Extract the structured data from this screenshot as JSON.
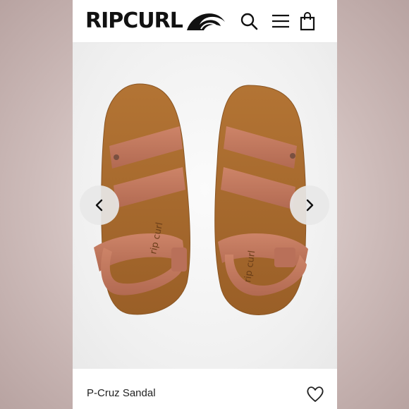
{
  "brand": {
    "name": "RIPCURL",
    "logo_icon": "wave-logo-icon"
  },
  "header": {
    "icons": {
      "search": "search-icon",
      "menu": "hamburger-menu-icon",
      "cart": "shopping-bag-icon"
    }
  },
  "gallery": {
    "prev_icon": "chevron-left-icon",
    "next_icon": "chevron-right-icon",
    "sandal_imprint": "rip curl"
  },
  "product": {
    "title": "P-Cruz Sandal",
    "favorite_icon": "heart-icon"
  },
  "colors": {
    "sole": "#a8692f",
    "strap": "#c2785e",
    "text": "#222222"
  }
}
